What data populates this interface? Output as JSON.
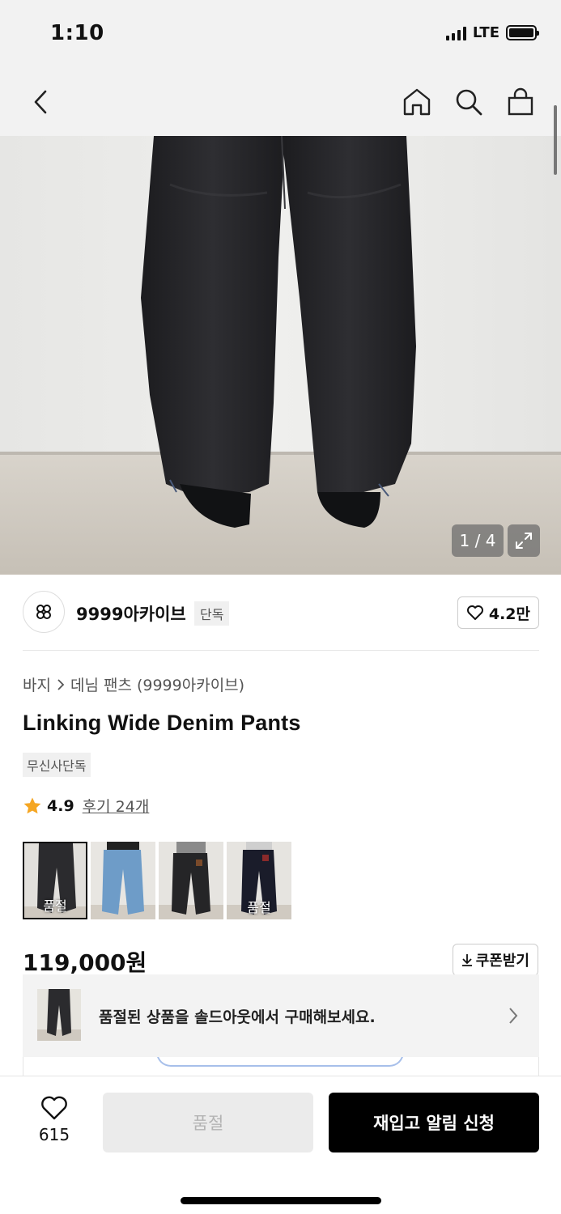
{
  "status_bar": {
    "time": "1:10",
    "network": "LTE"
  },
  "nav": {
    "back_icon": "chevron-left-icon",
    "home_icon": "home-icon",
    "search_icon": "search-icon",
    "cart_icon": "shopping-bag-icon"
  },
  "gallery": {
    "counter": "1 / 4",
    "expand_icon": "expand-icon"
  },
  "brand": {
    "name": "9999아카이브",
    "badge": "단독",
    "likes": "4.2만"
  },
  "breadcrumb": {
    "category": "바지",
    "subcategory": "데님 팬츠 (9999아카이브)"
  },
  "product": {
    "title": "Linking Wide Denim Pants",
    "store_badge": "무신사단독",
    "rating": "4.9",
    "reviews": "후기 24개",
    "price": "119,000원"
  },
  "variants": [
    {
      "color": "#2b2b2e",
      "soldout_label": "품절",
      "selected": true
    },
    {
      "color": "#6e9cc8",
      "soldout_label": "",
      "selected": false
    },
    {
      "color": "#252527",
      "soldout_label": "",
      "selected": false
    },
    {
      "color": "#1a1c2a",
      "soldout_label": "품절",
      "selected": false
    }
  ],
  "coupon": {
    "label": "쿠폰받기"
  },
  "soldout_banner": {
    "text": "품절된 상품을 솔드아웃에서 구매해보세요."
  },
  "bottom_bar": {
    "wish_count": "615",
    "soldout_label": "품절",
    "restock_label": "재입고 알림 신청"
  },
  "colors": {
    "accent_star": "#f5a623",
    "primary_button": "#000000"
  }
}
